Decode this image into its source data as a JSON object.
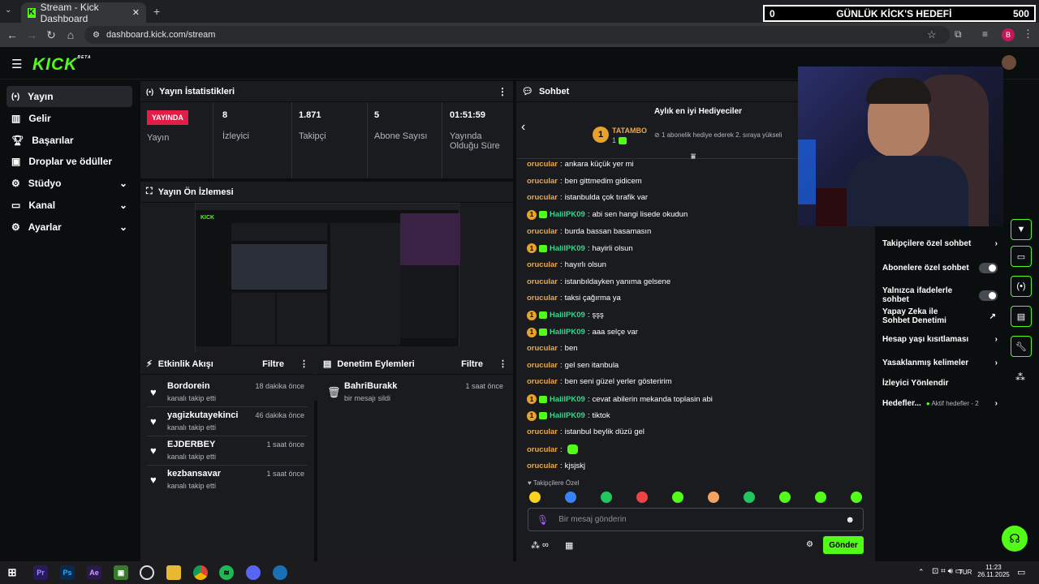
{
  "browser": {
    "tab_title": "Stream - Kick Dashboard",
    "url": "dashboard.kick.com/stream",
    "profile_initial": "B"
  },
  "goal_overlay": {
    "left": "0",
    "title": "GÜNLÜK KİCK'S HEDEFİ",
    "right": "500"
  },
  "logo": "KICK",
  "logo_beta": "BETA",
  "sidebar": {
    "items": [
      {
        "label": "Yayın",
        "icon": "broadcast-icon"
      },
      {
        "label": "Gelir",
        "icon": "revenue-icon"
      },
      {
        "label": "Başarılar",
        "icon": "trophy-icon"
      },
      {
        "label": "Droplar ve ödüller",
        "icon": "drops-icon"
      },
      {
        "label": "Stüdyo",
        "icon": "studio-icon"
      },
      {
        "label": "Kanal",
        "icon": "channel-icon"
      },
      {
        "label": "Ayarlar",
        "icon": "gear-icon"
      }
    ]
  },
  "stats": {
    "title": "Yayın İstatistikleri",
    "status_badge": "YAYINDA",
    "status_label": "Yayın",
    "viewers": "8",
    "viewers_label": "İzleyici",
    "followers": "1.871",
    "followers_label": "Takipçi",
    "subs": "5",
    "subs_label": "Abone Sayısı",
    "uptime": "01:51:59",
    "uptime_label": "Yayında Olduğu Süre"
  },
  "preview": {
    "title": "Yayın Ön İzlemesi"
  },
  "activity": {
    "title": "Etkinlik Akışı",
    "filter": "Filtre",
    "events": [
      {
        "name": "Bordorein",
        "action": "kanalı takip etti",
        "time": "18 dakika önce"
      },
      {
        "name": "yagizkutayekinci",
        "action": "kanalı takip etti",
        "time": "46 dakika önce"
      },
      {
        "name": "EJDERBEY",
        "action": "kanalı takip etti",
        "time": "1 saat önce"
      },
      {
        "name": "kezbansavar",
        "action": "kanalı takip etti",
        "time": "1 saat önce"
      }
    ]
  },
  "moderation": {
    "title": "Denetim Eylemleri",
    "filter": "Filtre",
    "events": [
      {
        "name": "BahriBurakk",
        "action": "bir mesajı sildi",
        "time": "1 saat önce"
      }
    ]
  },
  "chat": {
    "title": "Sohbet",
    "gifters_title": "Aylık en iyi Hediyeciler",
    "top_gifter": "TATAMBO",
    "top_gifter_rank": "1",
    "top_gifter_count": "1",
    "gifter_hint": "1 abonelik hediye ederek 2. sıraya yükseli",
    "messages": [
      {
        "user": "orucular",
        "text": "ankara küçük yer mi",
        "type": "plain"
      },
      {
        "user": "orucular",
        "text": "ben gittmedim gidicem",
        "type": "plain"
      },
      {
        "user": "orucular",
        "text": "istanbulda çok tırafik var",
        "type": "plain"
      },
      {
        "user": "HalilPK09",
        "text": "abi sen hangi lisede okudun",
        "type": "sub"
      },
      {
        "user": "orucular",
        "text": "burda bassan basamasın",
        "type": "plain"
      },
      {
        "user": "HalilPK09",
        "text": "hayirli olsun",
        "type": "sub"
      },
      {
        "user": "orucular",
        "text": "hayırlı olsun",
        "type": "plain"
      },
      {
        "user": "orucular",
        "text": "istanbıldayken yanıma gelsene",
        "type": "plain"
      },
      {
        "user": "orucular",
        "text": "taksi çağırma ya",
        "type": "plain"
      },
      {
        "user": "HalilPK09",
        "text": "şşş",
        "type": "sub"
      },
      {
        "user": "HalilPK09",
        "text": "aaa selçe var",
        "type": "sub"
      },
      {
        "user": "orucular",
        "text": "ben",
        "type": "plain"
      },
      {
        "user": "orucular",
        "text": "gel sen itanbula",
        "type": "plain"
      },
      {
        "user": "orucular",
        "text": "ben seni güzel yerler gösteririm",
        "type": "plain"
      },
      {
        "user": "HalilPK09",
        "text": "cevat abilerin mekanda toplasin abi",
        "type": "sub"
      },
      {
        "user": "HalilPK09",
        "text": "tiktok",
        "type": "sub"
      },
      {
        "user": "orucular",
        "text": "istanbul beylik düzü gel",
        "type": "plain"
      },
      {
        "user": "orucular",
        "text": "",
        "type": "emote"
      },
      {
        "user": "orucular",
        "text": "kjsjskj",
        "type": "plain"
      }
    ],
    "followers_only_label": "Takipçilere Özel",
    "input_placeholder": "Bir mesaj gönderin",
    "send_label": "Gönder",
    "infinity": "∞"
  },
  "chat_settings": {
    "followers_only": "Takipçilere özel sohbet",
    "subs_only": "Abonelere özel sohbet",
    "emotes_only": "Yalnızca ifadelerle sohbet",
    "ai_moderation": "Yapay Zeka ile Sohbet Denetimi",
    "account_age": "Hesap yaşı kısıtlaması",
    "banned_words": "Yasaklanmış kelimeler",
    "raid": "İzleyici Yönlendir",
    "goals": "Hedefler...",
    "active_goals": "Aktif hedefler - 2"
  },
  "taskbar": {
    "lang": "TUR",
    "time": "11:23",
    "date": "26.11.2025"
  },
  "colors": {
    "accent": "#53fc18",
    "live": "#e11d48",
    "panel": "#191b1f",
    "bg": "#0b0e0f"
  }
}
